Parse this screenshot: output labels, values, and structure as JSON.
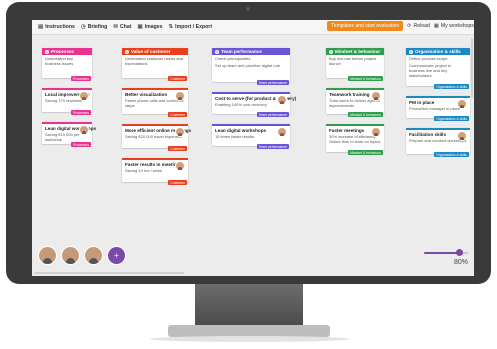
{
  "toolbar": {
    "items": [
      {
        "label": "Instructions",
        "icon": "book-icon",
        "glyph": "▤"
      },
      {
        "label": "Briefing",
        "icon": "clock-icon",
        "glyph": "◷"
      },
      {
        "label": "Chat",
        "icon": "chat-icon",
        "glyph": "✉"
      },
      {
        "label": "Images",
        "icon": "image-icon",
        "glyph": "▣"
      },
      {
        "label": "Import / Export",
        "icon": "import-export-icon",
        "glyph": "⇅"
      }
    ],
    "primary_action": "Templates and start evaluation",
    "reload": "Reload",
    "my_workshops": "My workshops"
  },
  "columns": [
    {
      "color": "#e8348e",
      "cards": [
        {
          "head": "Processes",
          "text": "Understand key business issues",
          "tag": "Processes",
          "avatar": false,
          "bar": "",
          "h": 30
        },
        {
          "title": "Local improvements",
          "text": "Saving 170 hrs/week",
          "tag": "Processes",
          "avatar": true,
          "bar": "#e8348e",
          "h": 24
        },
        {
          "title": "Lean digital workshops",
          "text": "Saving €10,000 per workshop",
          "tag": "Processes",
          "avatar": true,
          "bar": "#e8348e",
          "h": 22
        }
      ]
    },
    {
      "color": "#e8401c",
      "cards": [
        {
          "head": "Value of customer",
          "text": "Understand customer needs and expectations",
          "tag": "Customer",
          "avatar": false,
          "bar": "",
          "h": 30
        },
        {
          "title": "Better visualization",
          "text": "Fewer phone calls and corrective steps",
          "tag": "Customer",
          "avatar": true,
          "bar": "#e8401c",
          "h": 26
        },
        {
          "title": "More efficient online meetings",
          "text": "Saving €20,000 travel expenses",
          "tag": "Customer",
          "avatar": true,
          "bar": "#e8401c",
          "h": 24
        },
        {
          "title": "Faster results in meetings",
          "text": "Saving 10 hrs / week",
          "tag": "Customer",
          "avatar": true,
          "bar": "#e8401c",
          "h": 24
        }
      ]
    },
    {
      "color": "#6b55d6",
      "cards": [
        {
          "head": "Team performance",
          "text": "Check prerequisites",
          "text2": "Set up team and prioritize digital role",
          "tag": "Team performance",
          "avatar": false,
          "bar": "",
          "h": 34
        },
        {
          "title": "Cost to serve (for product & delivery)",
          "text": "Enabling 100% cost recovery",
          "tag": "Team performance",
          "avatar": true,
          "bar": "#6b55d6",
          "h": 22
        },
        {
          "title": "Lean digital workshops",
          "text": "15 times faster results",
          "tag": "Team performance",
          "avatar": true,
          "bar": "#6b55d6",
          "h": 22
        }
      ]
    },
    {
      "color": "#2e9e4e",
      "cards": [
        {
          "head": "Mindset & behaviour",
          "text": "Buy low-use before project launch",
          "tag": "Mindset & behaviour",
          "avatar": false,
          "bar": "",
          "h": 30
        },
        {
          "title": "Teamwork training",
          "text": "Train users to deliver agreed improvements",
          "tag": "Mindset & behaviour",
          "avatar": true,
          "bar": "#2e9e4e",
          "h": 26
        },
        {
          "title": "Faster meetings",
          "text": "30% increase of efficiency. Online time to work on topics",
          "tag": "Mindset & behaviour",
          "avatar": true,
          "bar": "#2e9e4e",
          "h": 28
        }
      ]
    },
    {
      "color": "#1d88c4",
      "cards": [
        {
          "head": "Organisation & skills",
          "text": "Define process scope",
          "text2": "Communicate project to business line and key stakeholders",
          "tag": "Organisation & skills",
          "avatar": false,
          "bar": "",
          "h": 38
        },
        {
          "title": "PM in place",
          "text": "Production manager in place",
          "tag": "Organisation & skills",
          "avatar": true,
          "bar": "#1d88c4",
          "h": 22
        },
        {
          "title": "Facilitation skills",
          "text": "Prepare and conduct workshops",
          "tag": "Organisation & skills",
          "avatar": true,
          "bar": "#1d88c4",
          "h": 26
        }
      ]
    }
  ],
  "footer": {
    "avatars": [
      "participant-1",
      "participant-2",
      "participant-3"
    ],
    "add_icon": "add-participant-icon",
    "zoom_label": "80%",
    "zoom_value": 0.8
  },
  "colors": {
    "accent": "#7a4aa8",
    "toolbar_action": "#f08a1c"
  }
}
